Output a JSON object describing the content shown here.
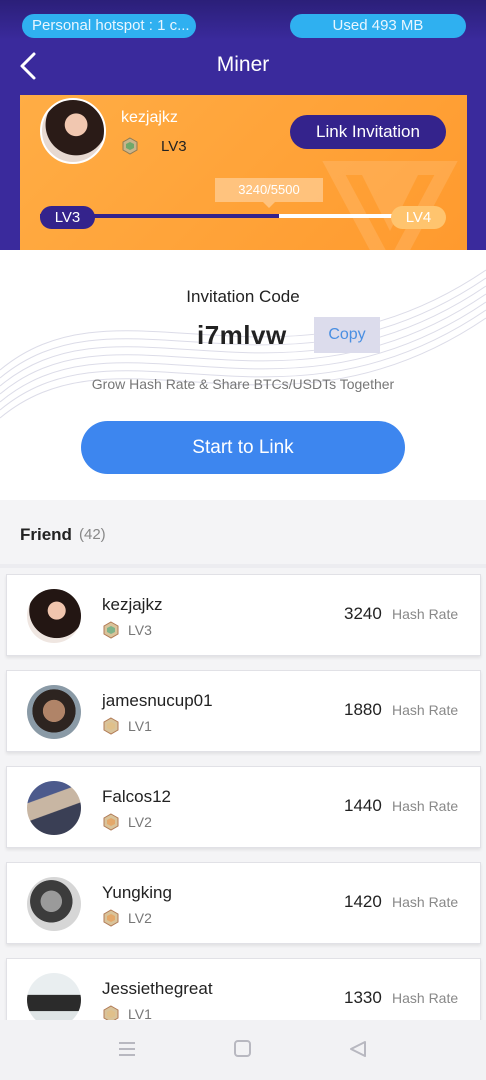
{
  "status": {
    "hotspot_text": "Personal hotspot : 1 c...",
    "used_text": "Used  493 MB"
  },
  "header": {
    "title": "Miner"
  },
  "profile": {
    "username": "kezjajkz",
    "level": "LV3",
    "link_button": "Link Invitation",
    "progress_text": "3240/5500",
    "progress_value": 3240,
    "progress_max": 5500,
    "level_from": "LV3",
    "level_to": "LV4"
  },
  "invitation": {
    "label": "Invitation Code",
    "code": "i7mlvw",
    "copy_button": "Copy",
    "tagline": "Grow Hash Rate & Share BTCs/USDTs Together",
    "start_button": "Start to Link"
  },
  "friends": {
    "title": "Friend",
    "count": "(42)",
    "hash_label": "Hash Rate",
    "items": [
      {
        "name": "kezjajkz",
        "level": "LV3",
        "hash": "3240"
      },
      {
        "name": "jamesnucup01",
        "level": "LV1",
        "hash": "1880"
      },
      {
        "name": "Falcos12",
        "level": "LV2",
        "hash": "1440"
      },
      {
        "name": "Yungking",
        "level": "LV2",
        "hash": "1420"
      },
      {
        "name": "Jessiethegreat",
        "level": "LV1",
        "hash": "1330"
      }
    ]
  },
  "colors": {
    "brand_purple": "#3a2a9c",
    "card_orange": "#ff9a2e",
    "accent_blue": "#3d86ef"
  }
}
